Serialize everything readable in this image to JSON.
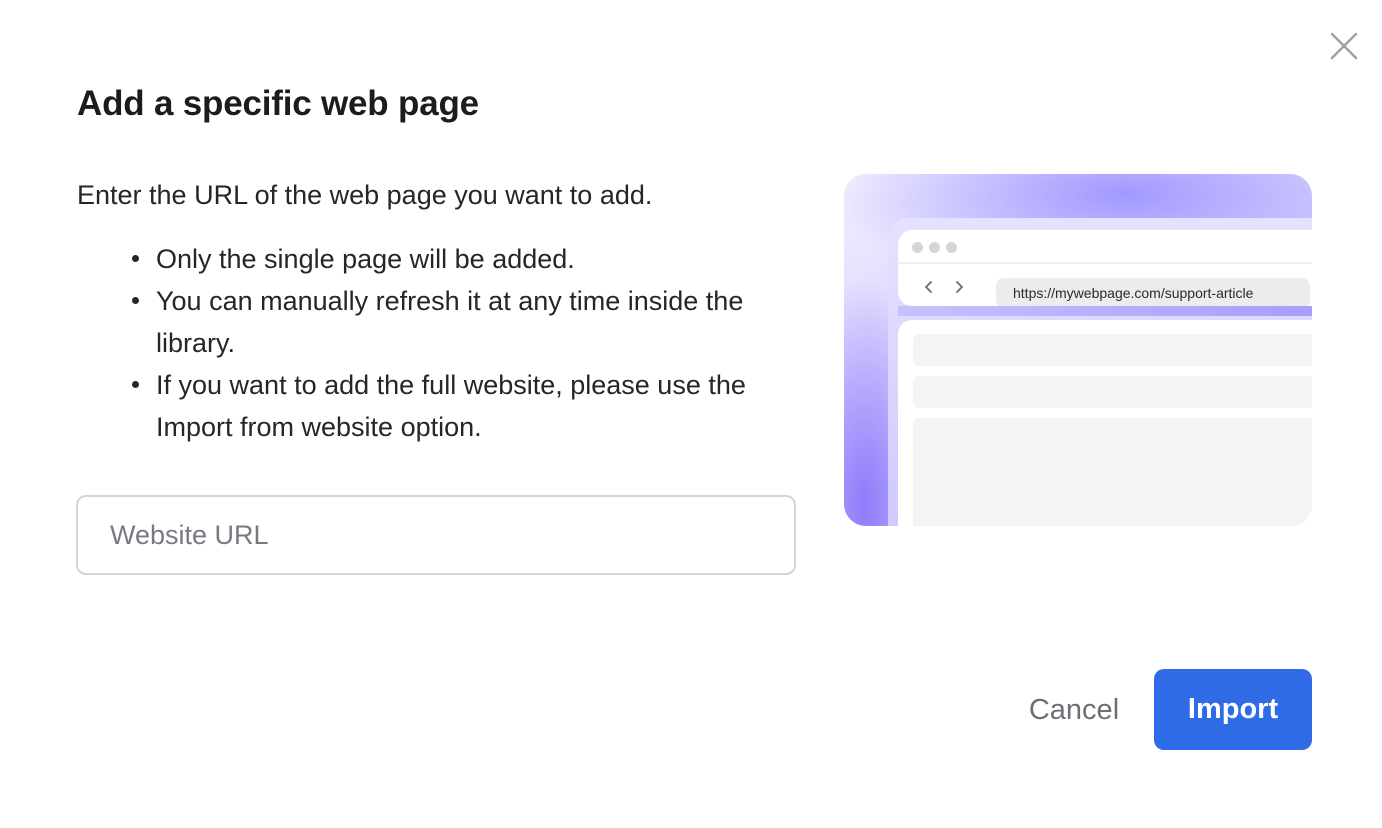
{
  "dialog": {
    "title": "Add a specific web page",
    "intro": "Enter the URL of the web page you want to add.",
    "bullets": [
      "Only the single page will be added.",
      "You can manually refresh it at any time inside the library.",
      "If you want to add the full website, please use the Import from website option."
    ],
    "input": {
      "placeholder": "Website URL",
      "value": ""
    },
    "illustration": {
      "address": "https://mywebpage.com/support-article"
    },
    "buttons": {
      "cancel": "Cancel",
      "import": "Import"
    },
    "icons": {
      "close": "close-icon",
      "back": "chevron-left-icon",
      "forward": "chevron-right-icon"
    },
    "colors": {
      "primary": "#2f6be6",
      "accent_gradient": "#b7b0ff"
    }
  }
}
